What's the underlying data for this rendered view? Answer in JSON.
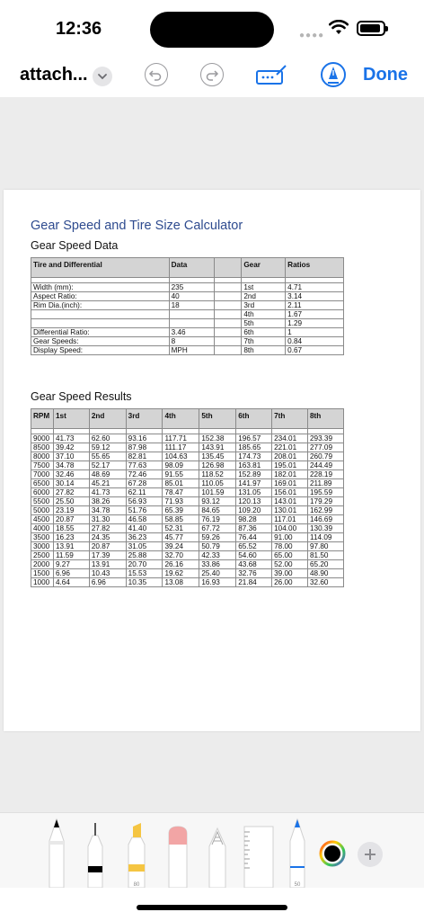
{
  "status": {
    "time": "12:36"
  },
  "toolbar": {
    "title": "attach...",
    "done_label": "Done"
  },
  "document": {
    "title": "Gear Speed and Tire Size Calculator",
    "data_heading": "Gear Speed Data",
    "results_heading": "Gear Speed Results",
    "data_table": {
      "headers": [
        "Tire and Differential",
        "Data",
        "",
        "Gear",
        "Ratios"
      ],
      "rows": [
        [
          "Width (mm):",
          "235",
          "",
          "1st",
          "4.71"
        ],
        [
          "Aspect Ratio:",
          "40",
          "",
          "2nd",
          "3.14"
        ],
        [
          "Rim Dia.(inch):",
          "18",
          "",
          "3rd",
          "2.11"
        ],
        [
          "",
          "",
          "",
          "4th",
          "1.67"
        ],
        [
          "",
          "",
          "",
          "5th",
          "1.29"
        ],
        [
          "Differential Ratio:",
          "3.46",
          "",
          "6th",
          "1"
        ],
        [
          "Gear Speeds:",
          "8",
          "",
          "7th",
          "0.84"
        ],
        [
          "Display Speed:",
          "MPH",
          "",
          "8th",
          "0.67"
        ]
      ]
    },
    "results_table": {
      "headers": [
        "RPM",
        "1st",
        "2nd",
        "3rd",
        "4th",
        "5th",
        "6th",
        "7th",
        "8th"
      ],
      "rows": [
        [
          "9000",
          "41.73",
          "62.60",
          "93.16",
          "117.71",
          "152.38",
          "196.57",
          "234.01",
          "293.39"
        ],
        [
          "8500",
          "39.42",
          "59.12",
          "87.98",
          "111.17",
          "143.91",
          "185.65",
          "221.01",
          "277.09"
        ],
        [
          "8000",
          "37.10",
          "55.65",
          "82.81",
          "104.63",
          "135.45",
          "174.73",
          "208.01",
          "260.79"
        ],
        [
          "7500",
          "34.78",
          "52.17",
          "77.63",
          "98.09",
          "126.98",
          "163.81",
          "195.01",
          "244.49"
        ],
        [
          "7000",
          "32.46",
          "48.69",
          "72.46",
          "91.55",
          "118.52",
          "152.89",
          "182.01",
          "228.19"
        ],
        [
          "6500",
          "30.14",
          "45.21",
          "67.28",
          "85.01",
          "110.05",
          "141.97",
          "169.01",
          "211.89"
        ],
        [
          "6000",
          "27.82",
          "41.73",
          "62.11",
          "78.47",
          "101.59",
          "131.05",
          "156.01",
          "195.59"
        ],
        [
          "5500",
          "25.50",
          "38.26",
          "56.93",
          "71.93",
          "93.12",
          "120.13",
          "143.01",
          "179.29"
        ],
        [
          "5000",
          "23.19",
          "34.78",
          "51.76",
          "65.39",
          "84.65",
          "109.20",
          "130.01",
          "162.99"
        ],
        [
          "4500",
          "20.87",
          "31.30",
          "46.58",
          "58.85",
          "76.19",
          "98.28",
          "117.01",
          "146.69"
        ],
        [
          "4000",
          "18.55",
          "27.82",
          "41.40",
          "52.31",
          "67.72",
          "87.36",
          "104.00",
          "130.39"
        ],
        [
          "3500",
          "16.23",
          "24.35",
          "36.23",
          "45.77",
          "59.26",
          "76.44",
          "91.00",
          "114.09"
        ],
        [
          "3000",
          "13.91",
          "20.87",
          "31.05",
          "39.24",
          "50.79",
          "65.52",
          "78.00",
          "97.80"
        ],
        [
          "2500",
          "11.59",
          "17.39",
          "25.88",
          "32.70",
          "42.33",
          "54.60",
          "65.00",
          "81.50"
        ],
        [
          "2000",
          "9.27",
          "13.91",
          "20.70",
          "26.16",
          "33.86",
          "43.68",
          "52.00",
          "65.20"
        ],
        [
          "1500",
          "6.96",
          "10.43",
          "15.53",
          "19.62",
          "25.40",
          "32.76",
          "39.00",
          "48.90"
        ],
        [
          "1000",
          "4.64",
          "6.96",
          "10.35",
          "13.08",
          "16.93",
          "21.84",
          "26.00",
          "32.60"
        ]
      ]
    }
  },
  "tools": {
    "marker_label": "80",
    "pencil_label": "50",
    "accent": "#1a73e8",
    "highlighter_color": "#f5c542",
    "eraser_color": "#f2a5a5"
  }
}
